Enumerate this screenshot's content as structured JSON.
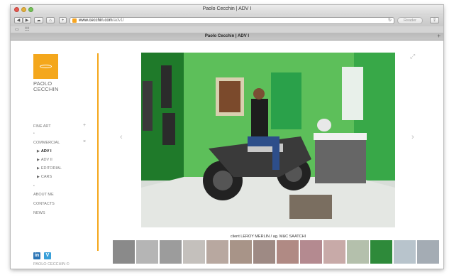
{
  "window": {
    "title": "Paolo Cecchin | ADV I"
  },
  "toolbar": {
    "back_icon": "chevron-left-icon",
    "forward_icon": "chevron-right-icon",
    "url_host": "www.cecchin.com",
    "url_path": "/adv1/",
    "reader_label": "Reader"
  },
  "tab": {
    "title": "Paolo Cecchin | ADV I"
  },
  "site": {
    "logo_name_line1": "PAOLO",
    "logo_name_line2": "CECCHIN",
    "brand_color": "#f4a71c",
    "nav": {
      "fine_art": "FINE ART",
      "commercial": "COMMERCIAL",
      "sub": [
        "ADV I",
        "ADV II",
        "EDITORIAL",
        "CARS"
      ],
      "about": "ABOUT ME",
      "contacts": "CONTACTS",
      "news": "NEWS",
      "plus": "+",
      "minus": "×"
    },
    "social": {
      "linkedin": "in",
      "vimeo": "V"
    },
    "footer_name": "PAOLO CECCHIN ©"
  },
  "gallery": {
    "caption": "client LEROY MERLIN / ag. M&C SAATCHI",
    "thumb_count": 14,
    "active_thumb": 10
  }
}
